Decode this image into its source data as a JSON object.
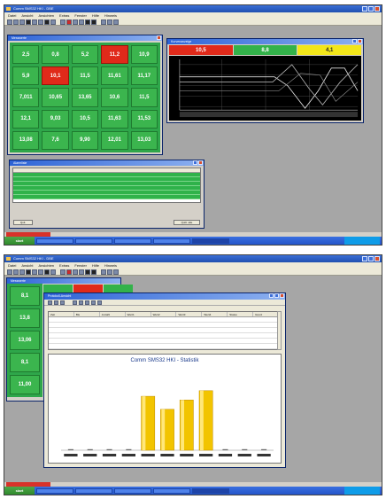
{
  "app": {
    "title": "Comm SMS32 HKI - DBE",
    "menu": [
      "Datei",
      "Ansicht",
      "Ansichten",
      "Extras",
      "Fenster",
      "Hilfe",
      "Hinweis"
    ]
  },
  "shot1": {
    "measures_window": {
      "title": "Messwerte"
    },
    "tiles": [
      {
        "label": "",
        "value": "2,5",
        "state": "green"
      },
      {
        "label": "",
        "value": "0,8",
        "state": "green"
      },
      {
        "label": "",
        "value": "5,2",
        "state": "green"
      },
      {
        "label": "",
        "value": "11,2",
        "state": "red"
      },
      {
        "label": "",
        "value": "10,9",
        "state": "green"
      },
      {
        "label": "",
        "value": "5,9",
        "state": "green"
      },
      {
        "label": "",
        "value": "10,1",
        "state": "red"
      },
      {
        "label": "",
        "value": "11,5",
        "state": "green"
      },
      {
        "label": "",
        "value": "11,61",
        "state": "green"
      },
      {
        "label": "",
        "value": "11,17",
        "state": "green"
      },
      {
        "label": "",
        "value": "7,011",
        "state": "green"
      },
      {
        "label": "",
        "value": "10,65",
        "state": "green"
      },
      {
        "label": "",
        "value": "13,65",
        "state": "green"
      },
      {
        "label": "",
        "value": "10,6",
        "state": "green"
      },
      {
        "label": "",
        "value": "11,5",
        "state": "green"
      },
      {
        "label": "",
        "value": "12,1",
        "state": "green"
      },
      {
        "label": "",
        "value": "9,03",
        "state": "green"
      },
      {
        "label": "",
        "value": "10,5",
        "state": "green"
      },
      {
        "label": "",
        "value": "11,63",
        "state": "green"
      },
      {
        "label": "",
        "value": "11,53",
        "state": "green"
      },
      {
        "label": "",
        "value": "13,08",
        "state": "green"
      },
      {
        "label": "",
        "value": "7,6",
        "state": "green"
      },
      {
        "label": "",
        "value": "9,90",
        "state": "green"
      },
      {
        "label": "",
        "value": "12,01",
        "state": "green"
      },
      {
        "label": "",
        "value": "13,03",
        "state": "green"
      }
    ],
    "graph_window": {
      "title": "Kurvenanzeige",
      "headers": [
        {
          "label": "",
          "value": "10,5",
          "state": "red"
        },
        {
          "label": "",
          "value": "8,8",
          "state": "green"
        },
        {
          "label": "",
          "value": "4,1",
          "state": "yellow"
        }
      ]
    },
    "alarm_window": {
      "title": "Alarmliste",
      "columns": [
        "",
        "",
        "",
        "",
        "",
        ""
      ],
      "button_left": "Quit.",
      "button_right": "Quitt. alle"
    },
    "status": [
      "",
      "",
      "",
      ""
    ],
    "tasks": [
      "",
      "",
      "",
      "",
      "",
      ""
    ],
    "tray_text": ""
  },
  "shot2": {
    "side_tiles": [
      {
        "value": "8,1"
      },
      {
        "value": "13,8"
      },
      {
        "value": "13,06"
      },
      {
        "value": "8,1"
      },
      {
        "value": "11,00"
      }
    ],
    "dialog": {
      "title": "Protokoll-Ansicht",
      "columns": [
        "Zeit",
        "Bis",
        "Anzahl",
        "Wert1",
        "Wert2",
        "Wert3",
        "Wert4",
        "Status",
        "Grenz"
      ],
      "rows": [
        [
          "",
          "",
          "",
          "",
          "",
          "",
          "",
          "",
          ""
        ],
        [
          "",
          "",
          "",
          "",
          "",
          "",
          "",
          "",
          ""
        ],
        [
          "",
          "",
          "",
          "",
          "",
          "",
          "",
          "",
          ""
        ],
        [
          "",
          "",
          "",
          "",
          "",
          "",
          "",
          "",
          ""
        ],
        [
          "",
          "",
          "",
          "",
          "",
          "",
          "",
          "",
          ""
        ],
        [
          "",
          "",
          "",
          "",
          "",
          "",
          "",
          "",
          ""
        ]
      ]
    },
    "status": [
      "",
      "",
      "",
      ""
    ],
    "tasks": [
      "",
      "",
      "",
      "",
      "",
      ""
    ],
    "tray_text": ""
  },
  "chart_data": {
    "type": "bar",
    "title": "Comm SMS32 HKI - Statistik",
    "subtitle": "",
    "categories": [
      "",
      "",
      "",
      "",
      "",
      "",
      "",
      "",
      "",
      "",
      ""
    ],
    "values": [
      0,
      0,
      0,
      0,
      29,
      22,
      27,
      32,
      0,
      0,
      0
    ],
    "bar_color": "#f2c400",
    "ylim": [
      0,
      40
    ]
  }
}
